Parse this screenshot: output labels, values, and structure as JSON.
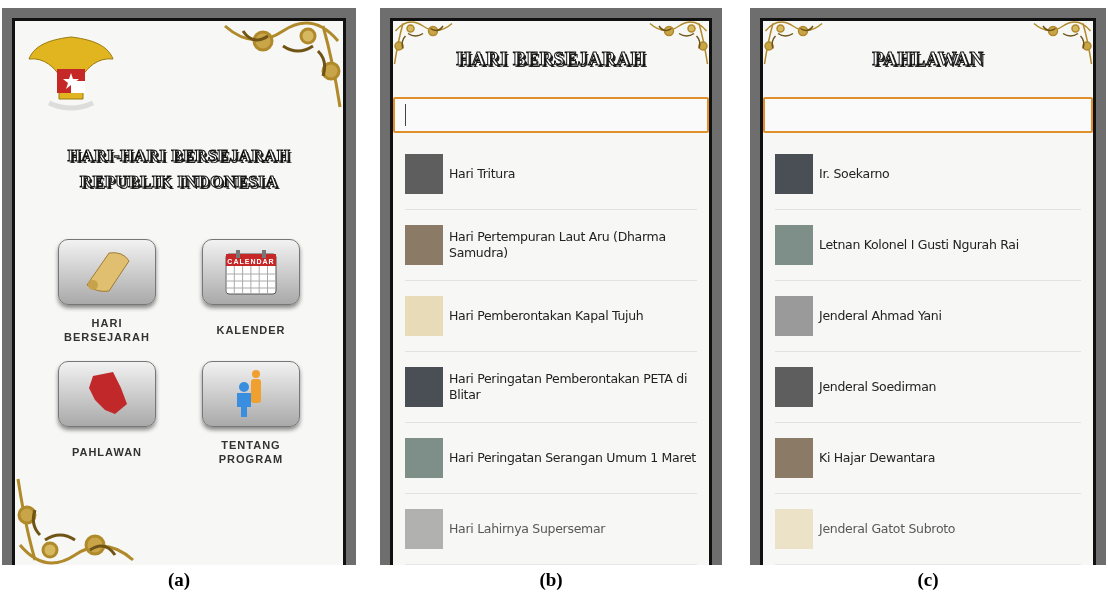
{
  "figures": [
    {
      "caption": "(a)",
      "screen": {
        "kind": "home",
        "title_lines": [
          "HARI-HARI BERSEJARAH",
          "REPUBLIK INDONESIA"
        ],
        "menu": [
          {
            "kind": "scroll",
            "label": "HARI BERSEJARAH"
          },
          {
            "kind": "calendar",
            "label": "KALENDER",
            "icon_text": "CALENDAR"
          },
          {
            "kind": "map",
            "label": "PAHLAWAN"
          },
          {
            "kind": "info",
            "label": "TENTANG PROGRAM"
          }
        ]
      }
    },
    {
      "caption": "(b)",
      "screen": {
        "kind": "list",
        "title": "HARI BERSEJARAH",
        "search": {
          "caret": true
        },
        "items": [
          {
            "label": "Hari Tritura"
          },
          {
            "label": "Hari Pertempuran Laut Aru (Dharma Samudra)"
          },
          {
            "label": "Hari Pemberontakan Kapal Tujuh"
          },
          {
            "label": "Hari Peringatan Pemberontakan PETA di Blitar"
          },
          {
            "label": "Hari Peringatan Serangan Umum 1 Maret"
          },
          {
            "label": "Hari Lahirnya Supersemar"
          }
        ]
      }
    },
    {
      "caption": "(c)",
      "screen": {
        "kind": "list",
        "title": "PAHLAWAN",
        "search": {
          "caret": false
        },
        "items": [
          {
            "label": "Ir. Soekarno"
          },
          {
            "label": "Letnan Kolonel I Gusti Ngurah Rai"
          },
          {
            "label": "Jenderal Ahmad Yani"
          },
          {
            "label": "Jenderal Soedirman"
          },
          {
            "label": "Ki Hajar Dewantara"
          },
          {
            "label": "Jenderal Gatot Subroto"
          }
        ]
      }
    }
  ]
}
